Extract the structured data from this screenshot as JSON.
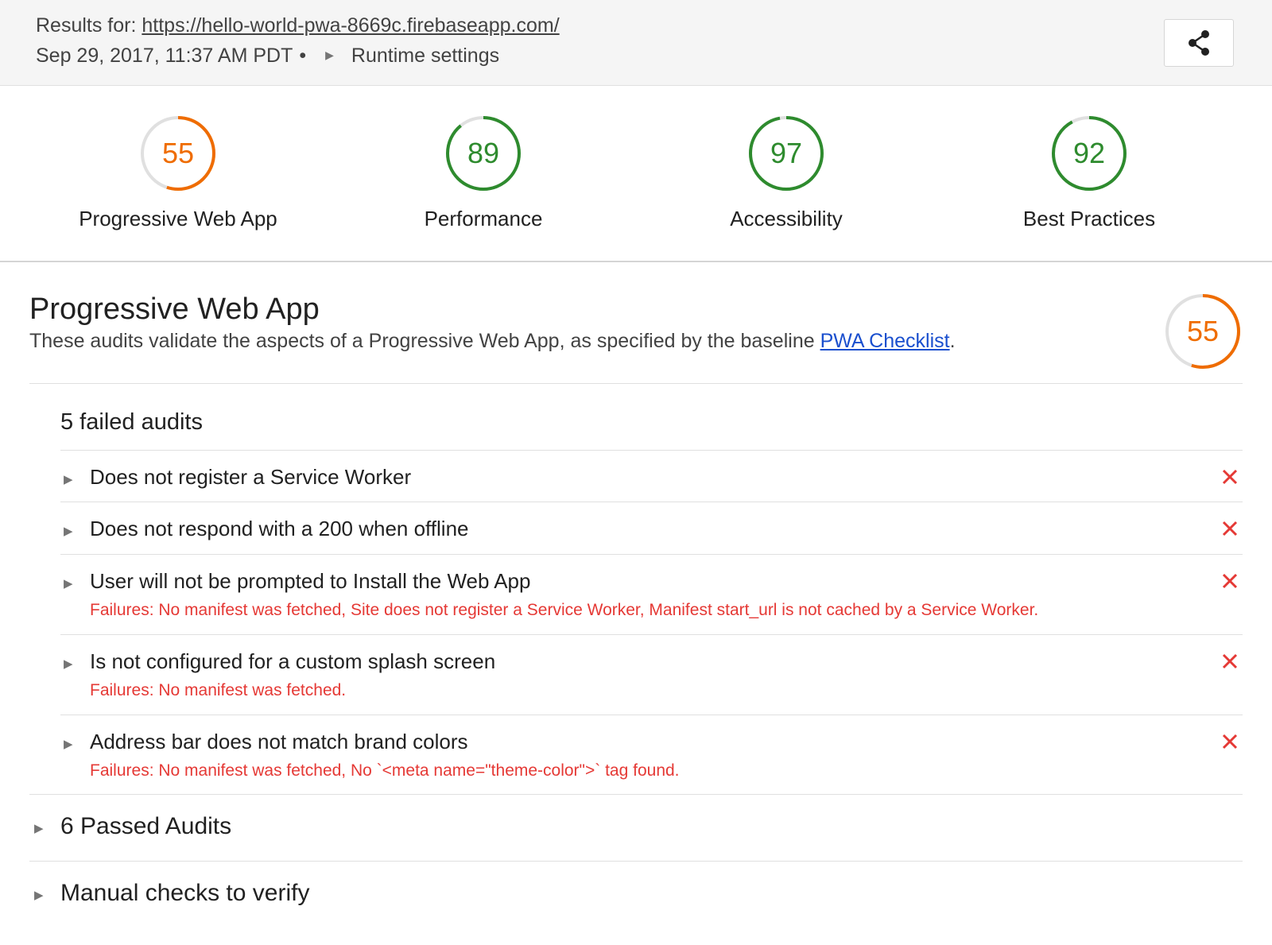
{
  "header": {
    "results_prefix": "Results for: ",
    "url": "https://hello-world-pwa-8669c.firebaseapp.com/",
    "timestamp": "Sep 29, 2017, 11:37 AM PDT",
    "separator": "•",
    "runtime_settings_label": "Runtime settings",
    "share_icon": "share-icon"
  },
  "gauges": [
    {
      "score": "55",
      "label": "Progressive Web App",
      "fraction": 0.55,
      "color": "#ef6c00"
    },
    {
      "score": "89",
      "label": "Performance",
      "fraction": 0.89,
      "color": "#2e8b2e"
    },
    {
      "score": "97",
      "label": "Accessibility",
      "fraction": 0.97,
      "color": "#2e8b2e"
    },
    {
      "score": "92",
      "label": "Best Practices",
      "fraction": 0.92,
      "color": "#2e8b2e"
    }
  ],
  "section": {
    "title": "Progressive Web App",
    "description_before": "These audits validate the aspects of a Progressive Web App, as specified by the baseline ",
    "checklist_link": "PWA Checklist",
    "description_after": ".",
    "score": "55",
    "fraction": 0.55,
    "color": "#ef6c00"
  },
  "failed_group": {
    "title": "5 failed audits",
    "audits": [
      {
        "title": "Does not register a Service Worker",
        "failure": ""
      },
      {
        "title": "Does not respond with a 200 when offline",
        "failure": ""
      },
      {
        "title": "User will not be prompted to Install the Web App",
        "failure": "Failures: No manifest was fetched, Site does not register a Service Worker, Manifest start_url is not cached by a Service Worker."
      },
      {
        "title": "Is not configured for a custom splash screen",
        "failure": "Failures: No manifest was fetched."
      },
      {
        "title": "Address bar does not match brand colors",
        "failure": "Failures: No manifest was fetched, No `<meta name=\"theme-color\">` tag found."
      }
    ]
  },
  "passed_group": {
    "title": "6 Passed Audits"
  },
  "manual_group": {
    "title": "Manual checks to verify"
  },
  "colors": {
    "fail": "#e53935",
    "pass": "#2e8b2e",
    "average": "#ef6c00",
    "link": "#1a4fce"
  }
}
